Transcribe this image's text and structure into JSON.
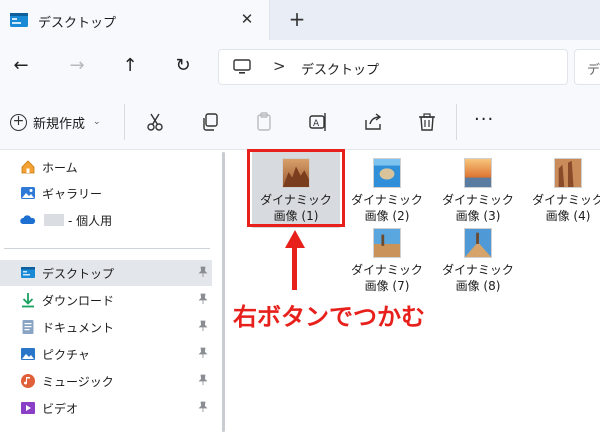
{
  "tab": {
    "title": "デスクトップ",
    "close": "✕",
    "new": "+"
  },
  "nav": {
    "back": "←",
    "forward": "→",
    "up": "↑",
    "refresh": "↻"
  },
  "address": {
    "separator": ">",
    "crumb": "デスクトップ",
    "search_placeholder": "デスクトップの検索"
  },
  "toolbar": {
    "new_label": "新規作成",
    "new_chevron": "⌄",
    "more": "···"
  },
  "sidebar": {
    "items": [
      {
        "label": "ホーム",
        "icon": "home-icon"
      },
      {
        "label": "ギャラリー",
        "icon": "gallery-icon"
      },
      {
        "label": "- 個人用",
        "icon": "onedrive-icon"
      },
      {
        "label": "デスクトップ",
        "icon": "desktop-icon",
        "selected": true
      },
      {
        "label": "ダウンロード",
        "icon": "download-icon"
      },
      {
        "label": "ドキュメント",
        "icon": "documents-icon"
      },
      {
        "label": "ピクチャ",
        "icon": "pictures-icon"
      },
      {
        "label": "ミュージック",
        "icon": "music-icon"
      },
      {
        "label": "ビデオ",
        "icon": "video-icon"
      }
    ]
  },
  "files": [
    {
      "line1": "ダイナミック",
      "line2": "画像 (1)",
      "selected": true
    },
    {
      "line1": "ダイナミック",
      "line2": "画像 (2)"
    },
    {
      "line1": "ダイナミック",
      "line2": "画像 (3)"
    },
    {
      "line1": "ダイナミック",
      "line2": "画像 (4)"
    },
    {
      "line1": "ダイナミック",
      "line2": "画像 (7)"
    },
    {
      "line1": "ダイナミック",
      "line2": "画像 (8)"
    }
  ],
  "annotation": {
    "text": "右ボタンでつかむ",
    "color": "#e8201c"
  },
  "colors": {
    "accent": "#e8201c",
    "selected_bg": "#d7dade",
    "chrome_bg": "#f7f9fc"
  }
}
